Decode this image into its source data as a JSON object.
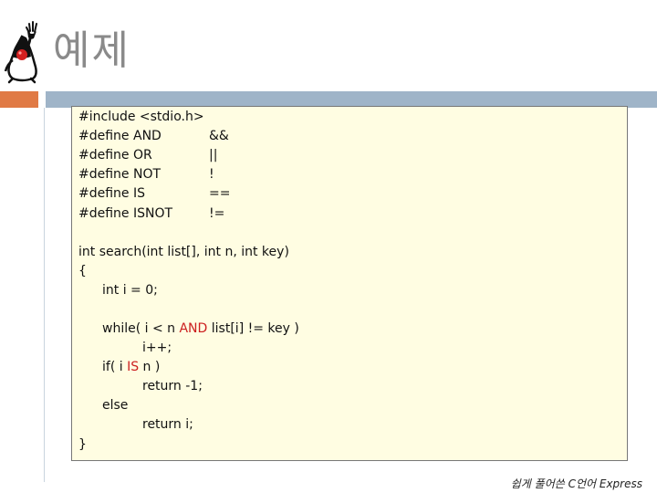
{
  "slide": {
    "title": "예제",
    "footer": "쉽게 풀어쓴 C언어 Express"
  },
  "code": {
    "defines": [
      {
        "left": "#include <stdio.h>",
        "right": ""
      },
      {
        "left": "#define AND",
        "right": "&&"
      },
      {
        "left": "#define OR",
        "right": "||"
      },
      {
        "left": "#define NOT",
        "right": "!"
      },
      {
        "left": "#define IS",
        "right": "=="
      },
      {
        "left": "#define ISNOT",
        "right": "!="
      }
    ],
    "func_signature": "int search(int list[], int n, int key)",
    "open_brace": "{",
    "init": "int i = 0;",
    "while_pre": "while( i < n ",
    "while_kw": "AND",
    "while_post": " list[i] != key )",
    "incr": "i++;",
    "if_pre": "if( i ",
    "if_kw": "IS",
    "if_post": " n )",
    "ret_neg": "return -1;",
    "else": "else",
    "ret_i": "return i;",
    "close_brace": "}"
  },
  "colors": {
    "accent_orange": "#e07a45",
    "accent_blue": "#9fb4c8",
    "code_background": "#fffde2",
    "keyword_highlight": "#cc1f1f"
  }
}
